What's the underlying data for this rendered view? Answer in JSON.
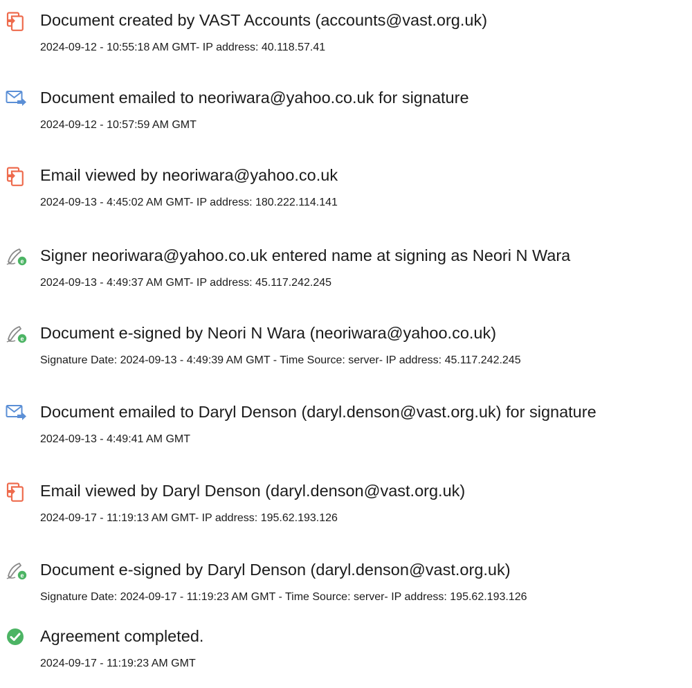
{
  "events": [
    {
      "icon": "document-created-icon",
      "title": "Document created by VAST Accounts (accounts@vast.org.uk)",
      "detail": "2024-09-12 - 10:55:18 AM GMT- IP address: 40.118.57.41"
    },
    {
      "icon": "email-sent-icon",
      "title": "Document emailed to neoriwara@yahoo.co.uk for signature",
      "detail": "2024-09-12 - 10:57:59 AM GMT"
    },
    {
      "icon": "document-viewed-icon",
      "title": "Email viewed by neoriwara@yahoo.co.uk",
      "detail": "2024-09-13 - 4:45:02 AM GMT- IP address: 180.222.114.141"
    },
    {
      "icon": "e-sign-pen-icon",
      "title": "Signer neoriwara@yahoo.co.uk entered name at signing as Neori N Wara",
      "detail": "2024-09-13 - 4:49:37 AM GMT- IP address: 45.117.242.245"
    },
    {
      "icon": "e-sign-pen-icon",
      "title": "Document e-signed by Neori N Wara (neoriwara@yahoo.co.uk)",
      "detail": "Signature Date: 2024-09-13 - 4:49:39 AM GMT - Time Source: server- IP address: 45.117.242.245"
    },
    {
      "icon": "email-sent-icon",
      "title": "Document emailed to Daryl Denson (daryl.denson@vast.org.uk) for signature",
      "detail": "2024-09-13 - 4:49:41 AM GMT"
    },
    {
      "icon": "document-viewed-icon",
      "title": "Email viewed by Daryl Denson (daryl.denson@vast.org.uk)",
      "detail": "2024-09-17 - 11:19:13 AM GMT- IP address: 195.62.193.126"
    },
    {
      "icon": "e-sign-pen-icon",
      "title": "Document e-signed by Daryl Denson (daryl.denson@vast.org.uk)",
      "detail": "Signature Date: 2024-09-17 - 11:19:23 AM GMT - Time Source: server- IP address: 195.62.193.126"
    },
    {
      "icon": "check-circle-icon",
      "title": "Agreement completed.",
      "detail": "2024-09-17 - 11:19:23 AM GMT"
    }
  ],
  "colors": {
    "document_icon": "#EE6B4D",
    "email_icon": "#5B8FD6",
    "pen_icon": "#8A8A8A",
    "e_badge": "#4CB464",
    "check_icon": "#4CB464",
    "text": "#1B1B1B"
  }
}
